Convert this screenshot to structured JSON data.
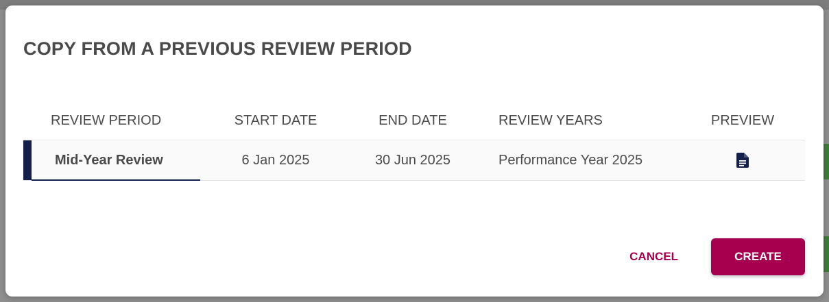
{
  "dialog": {
    "title": "COPY FROM A PREVIOUS REVIEW PERIOD"
  },
  "table": {
    "headers": {
      "review_period": "REVIEW PERIOD",
      "start_date": "START DATE",
      "end_date": "END DATE",
      "review_years": "REVIEW YEARS",
      "preview": "PREVIEW"
    },
    "rows": [
      {
        "review_period": "Mid-Year Review",
        "start_date": "6 Jan 2025",
        "end_date": "30 Jun 2025",
        "review_years": "Performance Year 2025",
        "preview_icon": "document-icon",
        "selected": true
      }
    ]
  },
  "actions": {
    "cancel_label": "CANCEL",
    "create_label": "CREATE"
  },
  "colors": {
    "accent": "#a5004f",
    "selection": "#15204a",
    "text": "#4a4a4a"
  }
}
